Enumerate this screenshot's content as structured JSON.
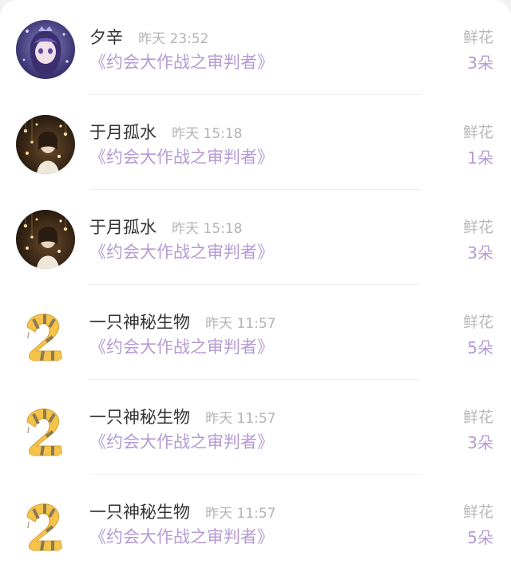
{
  "gift_list": {
    "rows": [
      {
        "user": "夕辛",
        "time": "昨天 23:52",
        "book": "《约会大作战之审判者》",
        "gift_type": "鲜花",
        "gift_count": "3朵",
        "avatar": "anime-girl-avatar"
      },
      {
        "user": "于月孤水",
        "time": "昨天 15:18",
        "book": "《约会大作战之审判者》",
        "gift_type": "鲜花",
        "gift_count": "1朵",
        "avatar": "fairy-lights-avatar"
      },
      {
        "user": "于月孤水",
        "time": "昨天 15:18",
        "book": "《约会大作战之审判者》",
        "gift_type": "鲜花",
        "gift_count": "3朵",
        "avatar": "fairy-lights-avatar"
      },
      {
        "user": "一只神秘生物",
        "time": "昨天 11:57",
        "book": "《约会大作战之审判者》",
        "gift_type": "鲜花",
        "gift_count": "5朵",
        "avatar": "striped-creature-avatar"
      },
      {
        "user": "一只神秘生物",
        "time": "昨天 11:57",
        "book": "《约会大作战之审判者》",
        "gift_type": "鲜花",
        "gift_count": "3朵",
        "avatar": "striped-creature-avatar"
      },
      {
        "user": "一只神秘生物",
        "time": "昨天 11:57",
        "book": "《约会大作战之审判者》",
        "gift_type": "鲜花",
        "gift_count": "5朵",
        "avatar": "striped-creature-avatar"
      }
    ]
  },
  "colors": {
    "accent_purple": "#b49ad4",
    "name_text": "#333333",
    "muted_text": "#b3b3b3",
    "creature_yellow": "#f5c24a"
  }
}
